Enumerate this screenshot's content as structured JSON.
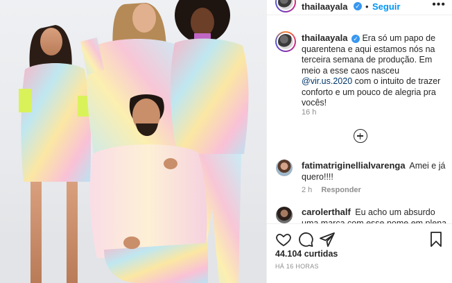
{
  "post": {
    "username": "thailaayala",
    "follow_label": "Seguir",
    "separator": "•",
    "more_label": "•••",
    "caption_text": "Era só um papo de quarentena e aqui estamos nós na terceira semana de produção. Em meio a esse caos nasceu",
    "caption_mention": "@vir.us.2020",
    "caption_text_end": "com o intuito de trazer conforto e um pouco de alegria pra vocês!",
    "caption_time": "16 h"
  },
  "comments": [
    {
      "username": "fatimatriginellialvarenga",
      "text": "Amei e já quero!!!!",
      "time": "2 h",
      "reply_label": "Responder"
    },
    {
      "username": "carolerthalf",
      "text": "Eu acho um absurdo uma marca com esse nome em plena"
    }
  ],
  "actions": {
    "likes_count": "44.104",
    "likes_label": "curtidas",
    "date": "HÁ 16 HORAS"
  },
  "colors": {
    "accent_blue": "#0095f6",
    "verified_blue": "#3897f0",
    "mention_blue": "#00376b",
    "muted": "#8e8e8e"
  },
  "icons": [
    "verified-badge-icon",
    "more-options-icon",
    "load-more-comments-icon",
    "heart-icon",
    "comment-bubble-icon",
    "share-plane-icon",
    "bookmark-icon"
  ]
}
